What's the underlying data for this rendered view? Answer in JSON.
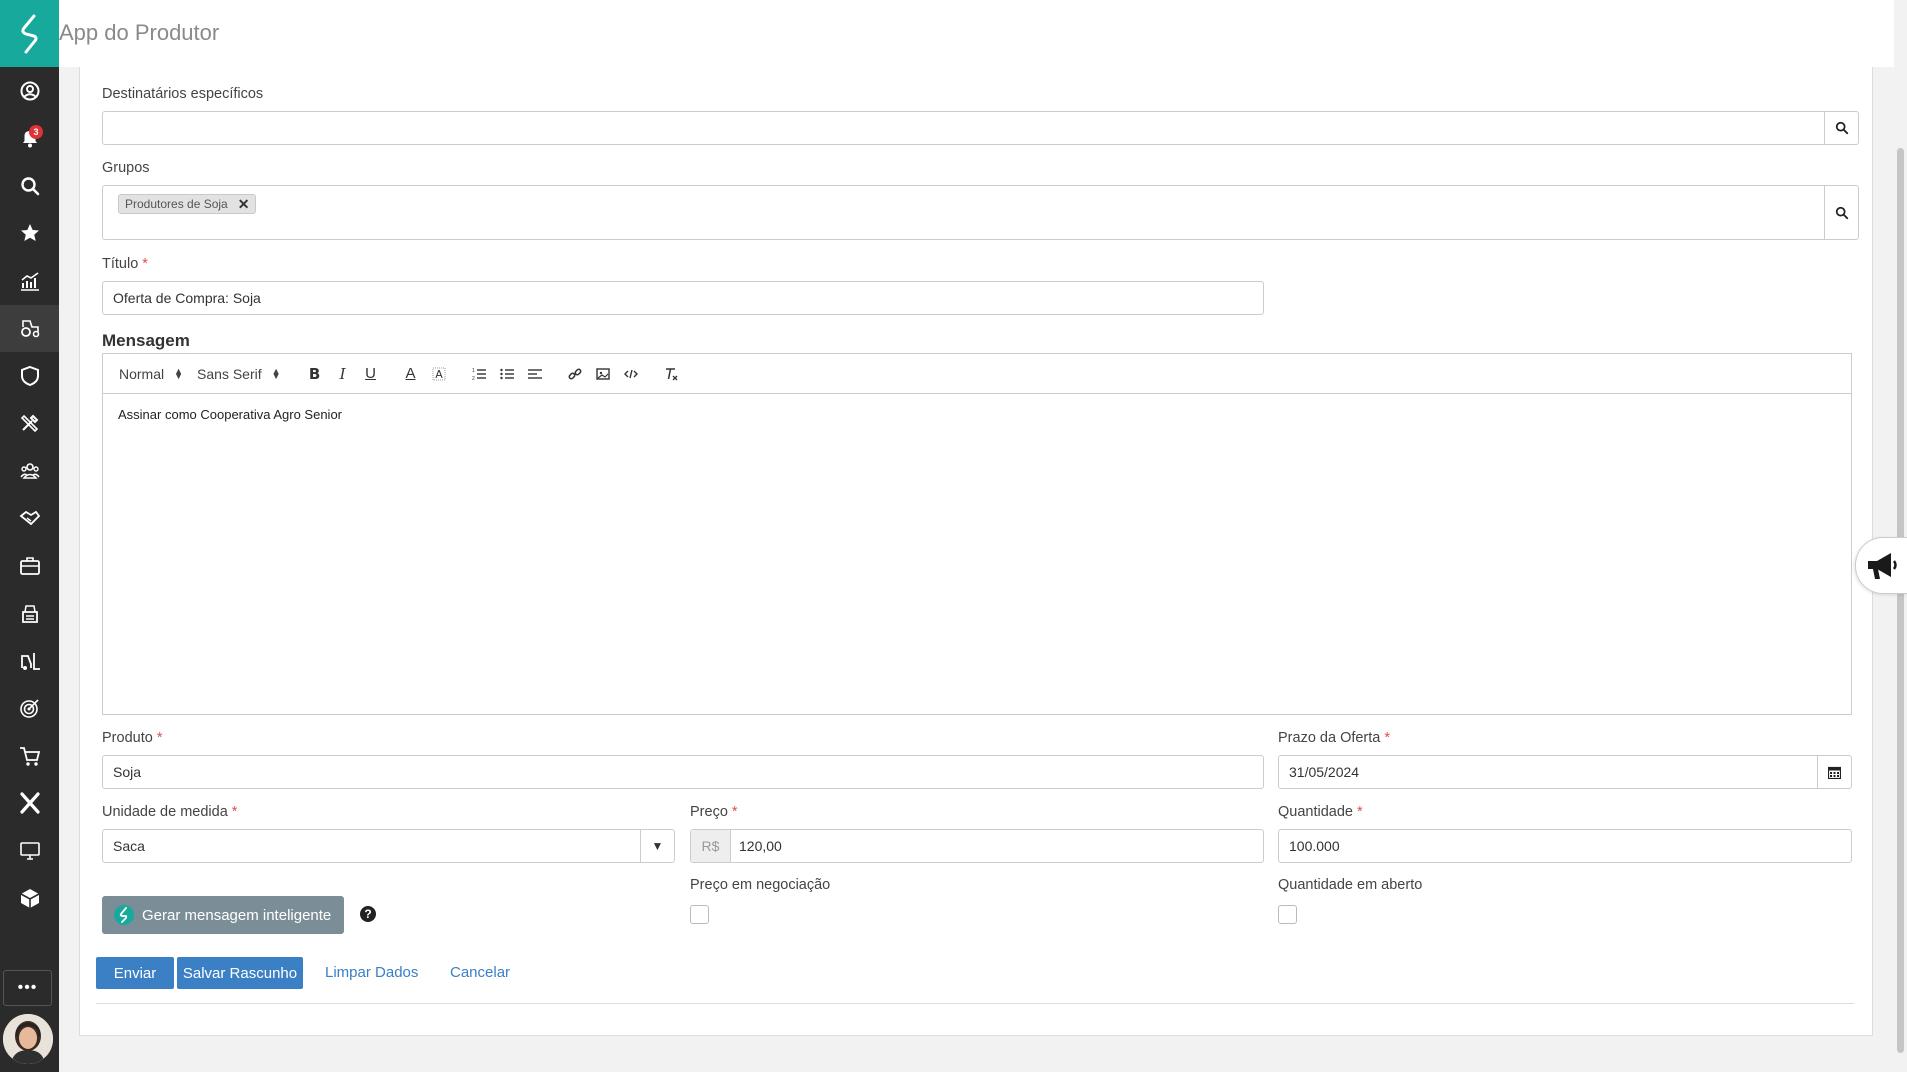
{
  "header": {
    "title": "App do Produtor"
  },
  "sidebar": {
    "notifications_count": "3",
    "items": [
      {
        "icon": "user-circle-icon"
      },
      {
        "icon": "bell-icon"
      },
      {
        "icon": "search-icon"
      },
      {
        "icon": "star-icon"
      },
      {
        "icon": "chart-growth-icon"
      },
      {
        "icon": "tractor-icon"
      },
      {
        "icon": "shield-icon"
      },
      {
        "icon": "tools-icon"
      },
      {
        "icon": "team-icon"
      },
      {
        "icon": "handshake-icon"
      },
      {
        "icon": "briefcase-icon"
      },
      {
        "icon": "cash-register-icon"
      },
      {
        "icon": "forklift-icon"
      },
      {
        "icon": "target-icon"
      },
      {
        "icon": "cart-icon"
      },
      {
        "icon": "x-icon"
      },
      {
        "icon": "monitor-icon"
      },
      {
        "icon": "cube-icon"
      }
    ],
    "more_label": "•••"
  },
  "form": {
    "recipients": {
      "label": "Destinatários específicos",
      "value": ""
    },
    "groups": {
      "label": "Grupos",
      "tags": [
        "Produtores de Soja"
      ]
    },
    "title": {
      "label": "Título",
      "required": "*",
      "value": "Oferta de Compra: Soja"
    },
    "message": {
      "label": "Mensagem",
      "toolbar": {
        "size": "Normal",
        "font": "Sans Serif"
      },
      "body": "Assinar como Cooperativa Agro Senior"
    },
    "product": {
      "label": "Produto",
      "required": "*",
      "value": "Soja"
    },
    "deadline": {
      "label": "Prazo da Oferta",
      "required": "*",
      "value": "31/05/2024"
    },
    "unit": {
      "label": "Unidade de medida",
      "required": "*",
      "value": "Saca"
    },
    "price": {
      "label": "Preço",
      "required": "*",
      "currency": "R$",
      "value": "120,00"
    },
    "quantity": {
      "label": "Quantidade",
      "required": "*",
      "value": "100.000"
    },
    "price_negotiation": {
      "label": "Preço em negociação",
      "checked": false
    },
    "open_quantity": {
      "label": "Quantidade em aberto",
      "checked": false
    }
  },
  "actions": {
    "generate": "Gerar mensagem inteligente",
    "help": "?",
    "send": "Enviar",
    "save_draft": "Salvar Rascunho",
    "clear": "Limpar Dados",
    "cancel": "Cancelar"
  },
  "colors": {
    "brand": "#17a99b",
    "sidebar": "#2b2b2b",
    "primary": "#3b7fc4",
    "required": "#d9534f"
  }
}
